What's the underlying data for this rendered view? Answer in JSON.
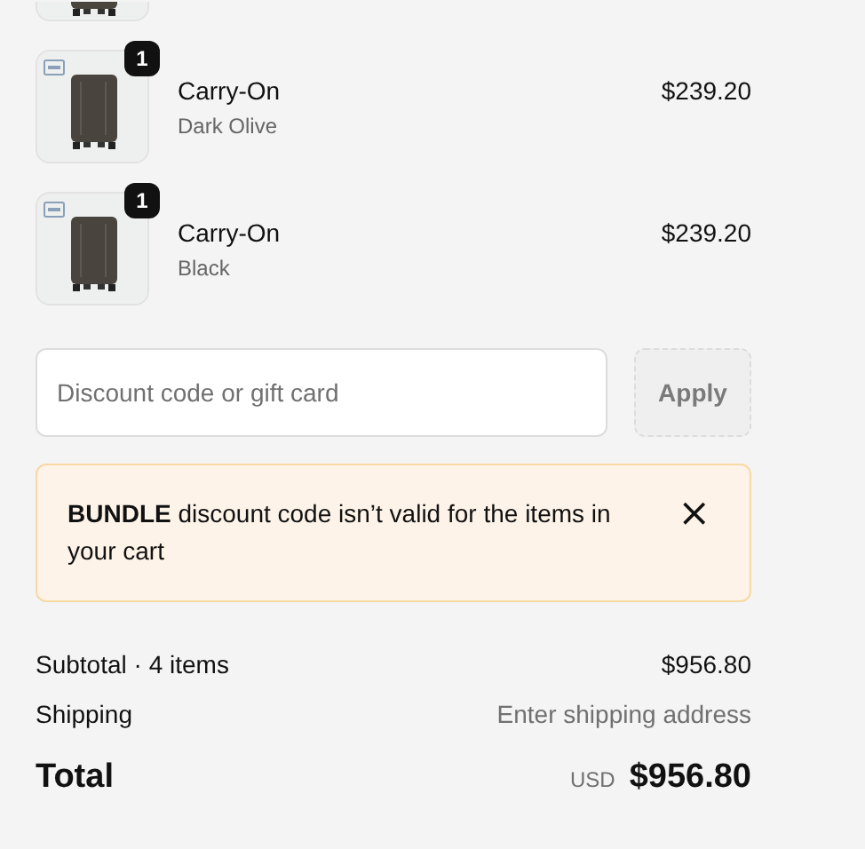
{
  "items": [
    {
      "kind": "clipped"
    },
    {
      "kind": "product",
      "quantity": "1",
      "title": "Carry-On",
      "variant": "Dark Olive",
      "price": "$239.20"
    },
    {
      "kind": "product",
      "quantity": "1",
      "title": "Carry-On",
      "variant": "Black",
      "price": "$239.20"
    }
  ],
  "discount": {
    "placeholder": "Discount code or gift card",
    "button": "Apply"
  },
  "alert": {
    "message": "**BUNDLE** discount code isn’t valid for the items in your cart",
    "close": "×"
  },
  "summary": [
    {
      "label": "Subtotal · 4 items",
      "value": "$956.80",
      "kind": "amount"
    },
    {
      "label": "Shipping",
      "value": "Enter shipping address",
      "kind": "hint"
    }
  ],
  "total": {
    "label": "Total",
    "currency": "USD",
    "value": "$956.80"
  }
}
